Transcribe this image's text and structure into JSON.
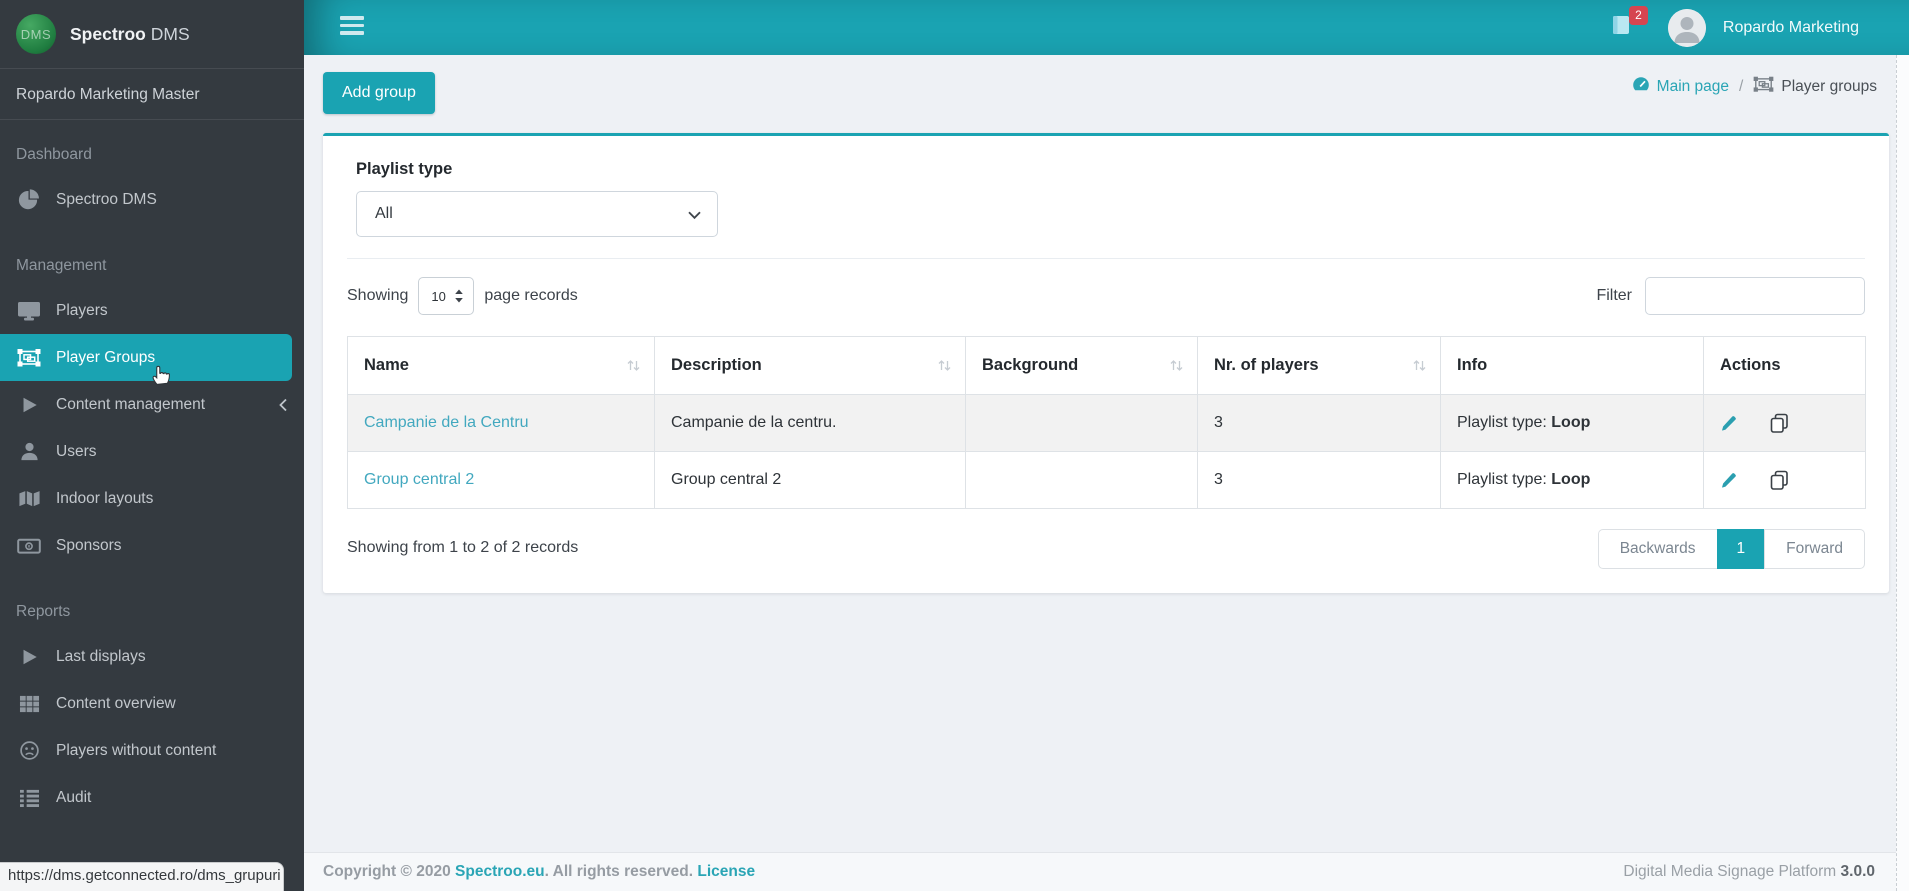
{
  "colors": {
    "accent": "#1aa3b2",
    "sidebar_bg": "#343a40",
    "link": "#42a8bf",
    "badge": "#d64550",
    "active_item": "#1aa3b2"
  },
  "brand": {
    "logo": "DMS",
    "title_bold": "Spectroo",
    "title_light": "DMS"
  },
  "profile": {
    "workspace": "Ropardo Marketing Master"
  },
  "topbar": {
    "badge_count": "2",
    "user_name": "Ropardo Marketing"
  },
  "sidebar": {
    "entries": [
      {
        "type": "header",
        "label": "Dashboard"
      },
      {
        "type": "item",
        "icon": "pie-chart-icon",
        "label": "Spectroo DMS"
      },
      {
        "type": "header",
        "label": "Management"
      },
      {
        "type": "item",
        "icon": "desktop-icon",
        "label": "Players"
      },
      {
        "type": "item",
        "icon": "object-group-icon",
        "label": "Player Groups",
        "active": true
      },
      {
        "type": "item",
        "icon": "play-icon",
        "label": "Content management",
        "collapsible": true
      },
      {
        "type": "item",
        "icon": "user-icon",
        "label": "Users"
      },
      {
        "type": "item",
        "icon": "map-icon",
        "label": "Indoor layouts"
      },
      {
        "type": "item",
        "icon": "money-icon",
        "label": "Sponsors"
      },
      {
        "type": "header",
        "label": "Reports"
      },
      {
        "type": "item",
        "icon": "play-icon",
        "label": "Last displays"
      },
      {
        "type": "item",
        "icon": "grid-icon",
        "label": "Content overview"
      },
      {
        "type": "item",
        "icon": "frown-icon",
        "label": "Players without content"
      },
      {
        "type": "item",
        "icon": "list-icon",
        "label": "Audit"
      }
    ]
  },
  "breadcrumb": {
    "main": "Main page",
    "separator": "/",
    "current": "Player groups"
  },
  "actions": {
    "add_group": "Add group"
  },
  "filter_panel": {
    "label": "Playlist type",
    "selected": "All"
  },
  "list_controls": {
    "showing": "Showing",
    "page_size": "10",
    "records": "page records",
    "filter_label": "Filter",
    "filter_value": ""
  },
  "table": {
    "headers": [
      {
        "label": "Name",
        "sortable": true
      },
      {
        "label": "Description",
        "sortable": true
      },
      {
        "label": "Background",
        "sortable": true
      },
      {
        "label": "Nr. of players",
        "sortable": true
      },
      {
        "label": "Info",
        "sortable": false
      },
      {
        "label": "Actions",
        "sortable": false
      }
    ],
    "rows": [
      {
        "name": "Campanie de la Centru",
        "description": "Campanie de la centru.",
        "background": "",
        "players": "3",
        "info_label": "Playlist type: ",
        "info_value": "Loop"
      },
      {
        "name": "Group central 2",
        "description": "Group central 2",
        "background": "",
        "players": "3",
        "info_label": "Playlist type: ",
        "info_value": "Loop"
      }
    ]
  },
  "pagination": {
    "summary": "Showing from 1 to 2 of 2 records",
    "backwards": "Backwards",
    "current_page": "1",
    "forward": "Forward"
  },
  "footer": {
    "copyright_prefix": "Copyright © 2020 ",
    "brand_link": "Spectroo.eu",
    "rights": ". All rights reserved. ",
    "license_link": "License",
    "platform": "Digital Media Signage Platform ",
    "version": "3.0.0"
  },
  "statusbar": {
    "url": "https://dms.getconnected.ro/dms_grupuri"
  },
  "icons": [
    "hamburger-icon",
    "notifications-icon",
    "avatar",
    "dashboard-gauge-icon",
    "object-group-icon",
    "pie-chart-icon",
    "desktop-icon",
    "play-icon",
    "user-icon",
    "map-icon",
    "money-icon",
    "grid-icon",
    "frown-icon",
    "list-icon",
    "sort-icon",
    "edit-pencil-icon",
    "clone-icon",
    "chevron-down-icon",
    "chevron-left-icon",
    "spinner-icon",
    "cursor-hand-icon"
  ]
}
